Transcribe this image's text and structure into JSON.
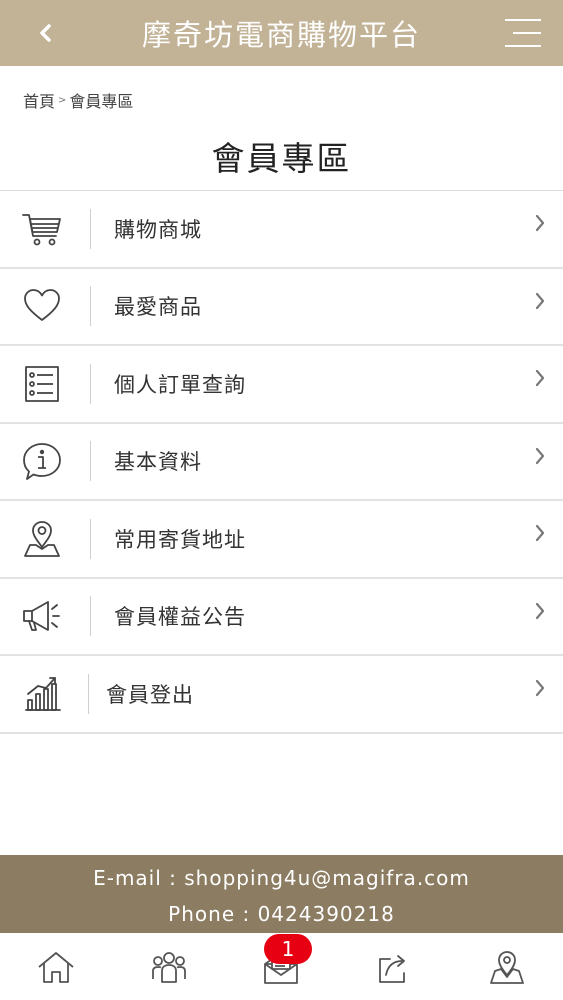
{
  "header": {
    "title": "摩奇坊電商購物平台"
  },
  "breadcrumb": {
    "home": "首頁",
    "separator": ">",
    "current": "會員專區"
  },
  "page_title": "會員專區",
  "menu": {
    "items": [
      {
        "label": "購物商城",
        "icon": "shopping-cart-icon"
      },
      {
        "label": "最愛商品",
        "icon": "heart-icon"
      },
      {
        "label": "個人訂單查詢",
        "icon": "order-list-icon"
      },
      {
        "label": "基本資料",
        "icon": "info-icon"
      },
      {
        "label": "常用寄貨地址",
        "icon": "map-pin-icon"
      },
      {
        "label": "會員權益公告",
        "icon": "megaphone-icon"
      },
      {
        "label": "會員登出",
        "icon": "bar-chart-icon"
      }
    ]
  },
  "footer": {
    "email": "E-mail : shopping4u@magifra.com",
    "phone": "Phone : 0424390218"
  },
  "tabbar": {
    "items": [
      "home-icon",
      "members-icon",
      "mail-icon",
      "share-icon",
      "location-icon"
    ],
    "mail_badge": "1"
  },
  "colors": {
    "header": "#c2b296",
    "footer": "#8c7c62",
    "badge": "#e60012"
  }
}
